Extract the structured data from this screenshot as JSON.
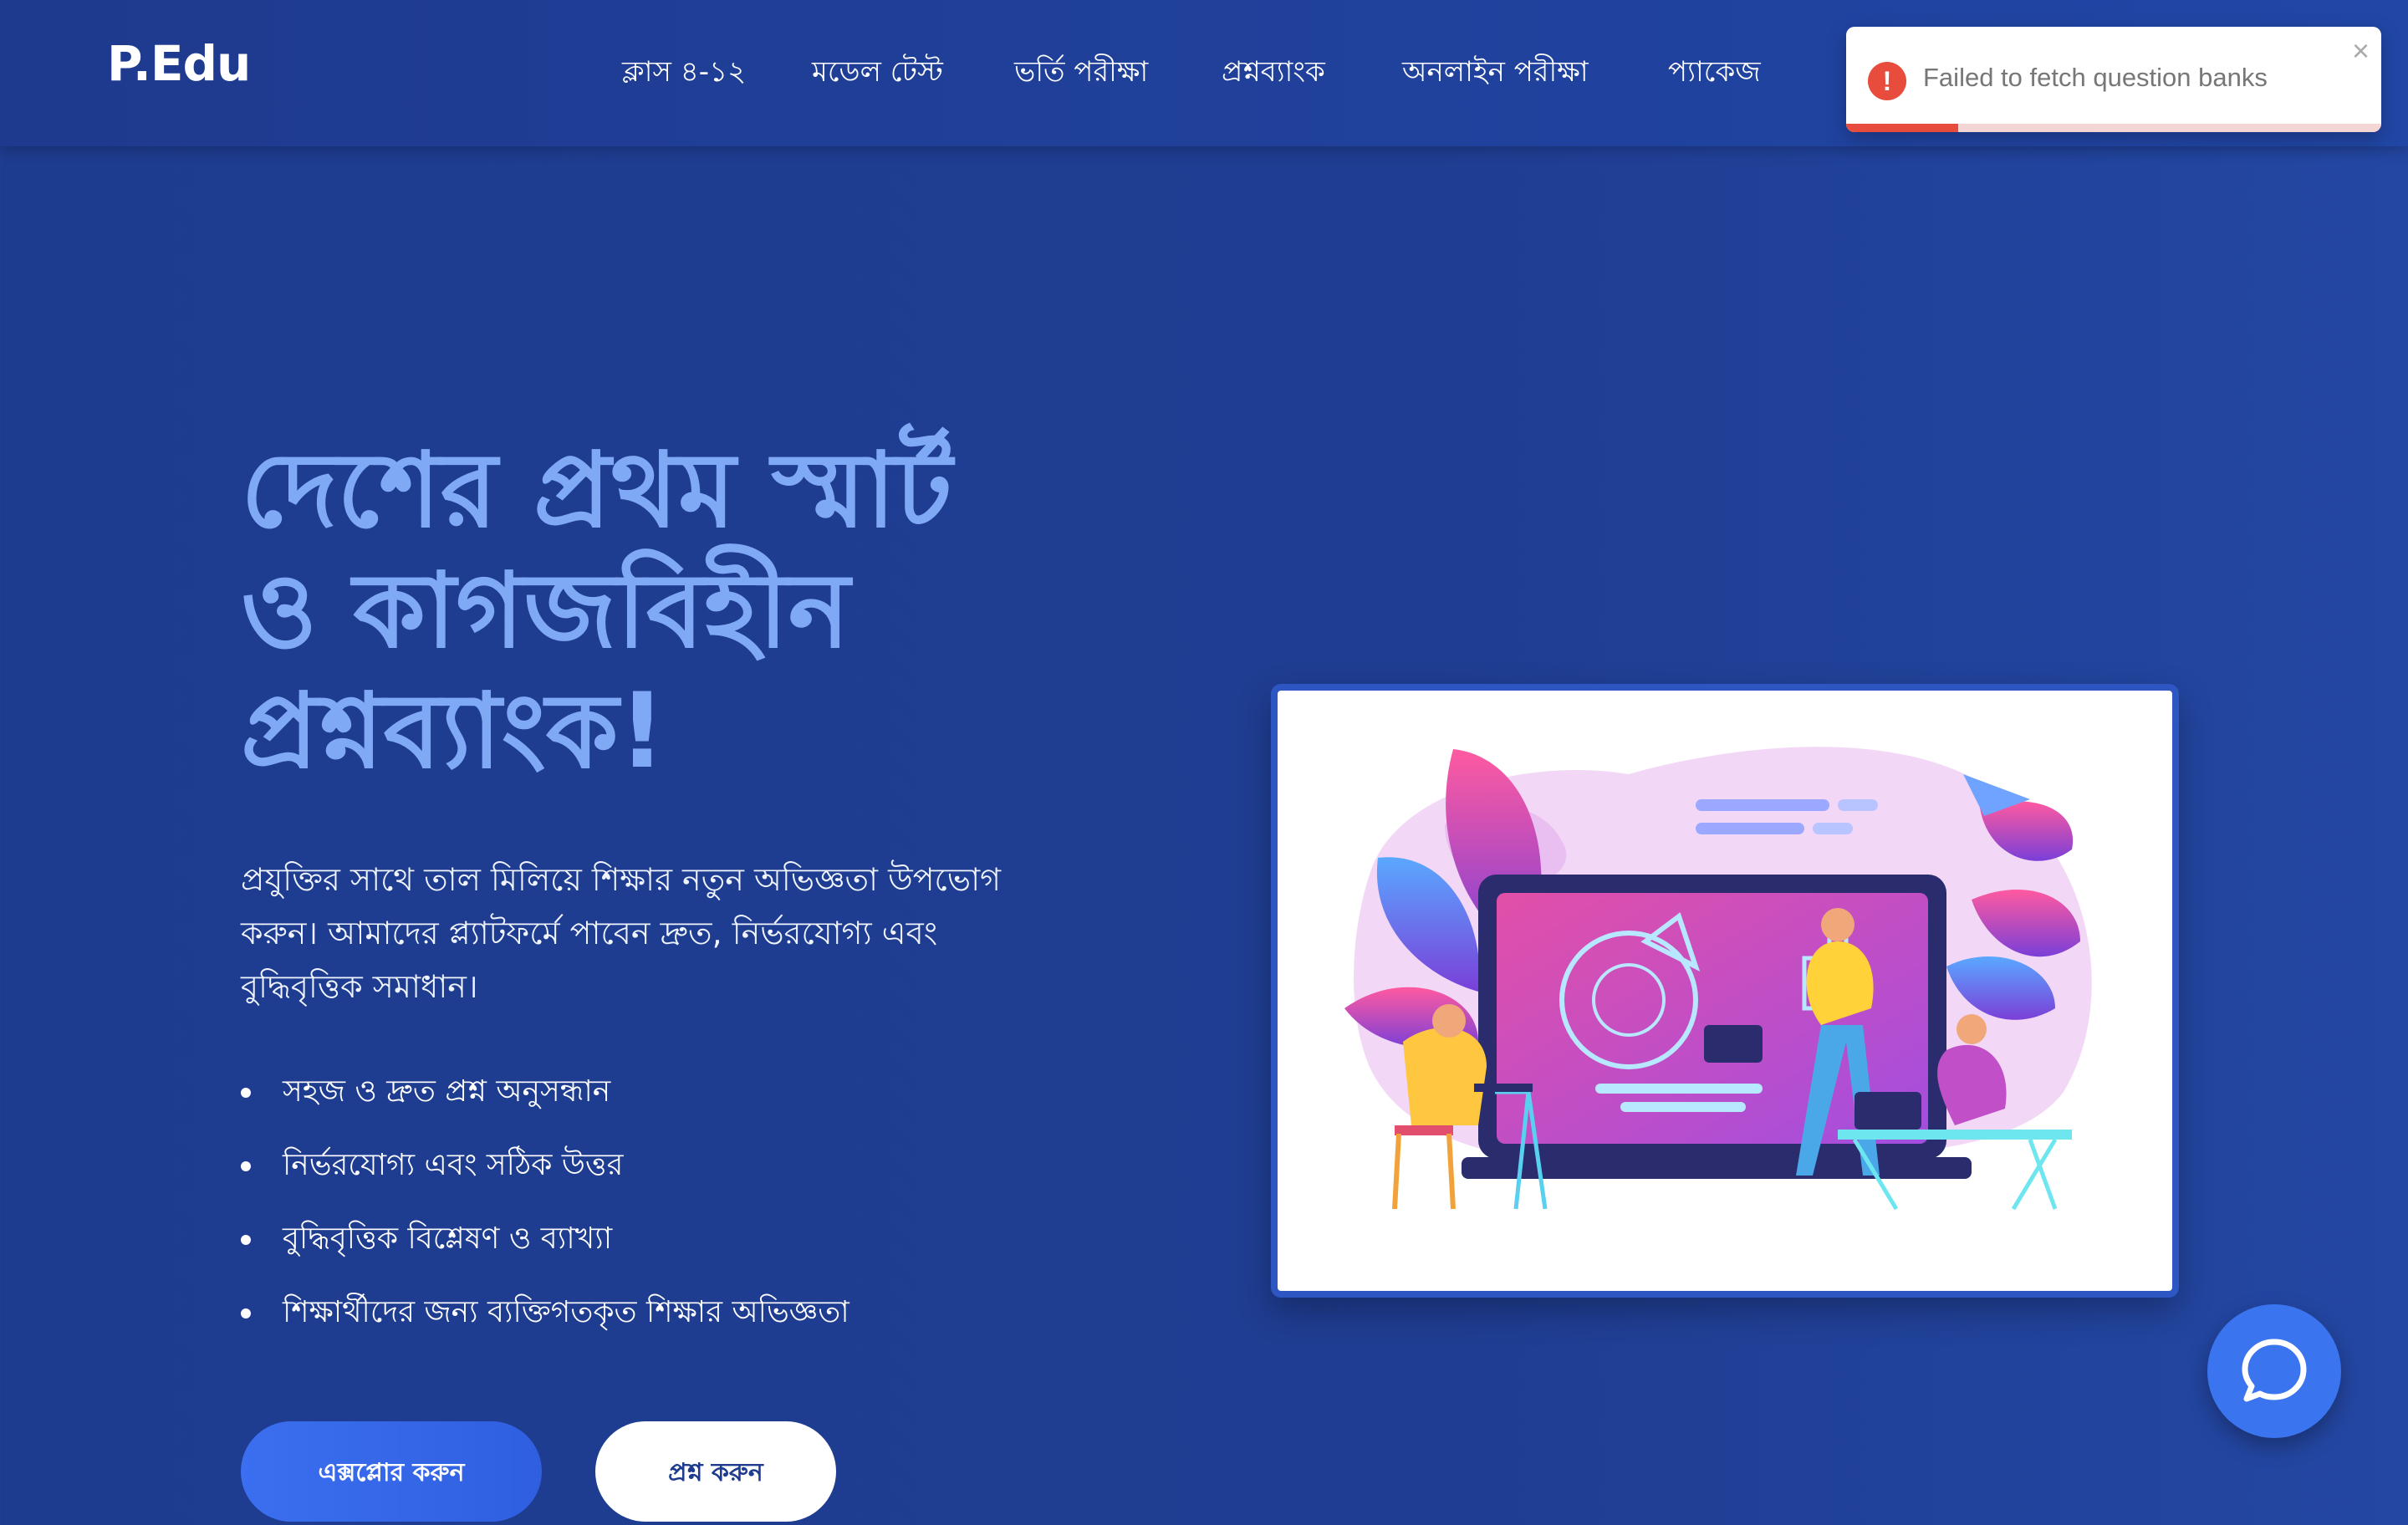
{
  "header": {
    "logo": "P.Edu",
    "nav": [
      {
        "label": "ক্লাস ৪-১২"
      },
      {
        "label": "মডেল টেস্ট"
      },
      {
        "label": "ভর্তি পরীক্ষা"
      },
      {
        "label": "প্রশ্নব্যাংক"
      },
      {
        "label": "অনলাইন পরীক্ষা"
      },
      {
        "label": "প্যাকেজ"
      }
    ]
  },
  "toast": {
    "icon": "alert-icon",
    "icon_glyph": "!",
    "message": "Failed to fetch question banks",
    "close_glyph": "×",
    "progress": 0.21,
    "color": "#e74c3c"
  },
  "hero": {
    "title_lines": [
      "দেশের প্রথম স্মার্ট",
      "ও কাগজবিহীন",
      "প্রশ্নব্যাংক!"
    ],
    "description": "প্রযুক্তির সাথে তাল মিলিয়ে শিক্ষার নতুন অভিজ্ঞতা উপভোগ করুন। আমাদের প্ল্যাটফর্মে পাবেন দ্রুত, নির্ভরযোগ্য এবং বুদ্ধিবৃত্তিক সমাধান।",
    "features": [
      "সহজ ও দ্রুত প্রশ্ন অনুসন্ধান",
      "নির্ভরযোগ্য এবং সঠিক উত্তর",
      "বুদ্ধিবৃত্তিক বিশ্লেষণ ও ব্যাখ্যা",
      "শিক্ষার্থীদের জন্য ব্যক্তিগতকৃত শিক্ষার অভিজ্ঞতা"
    ],
    "primary_button": "এক্সপ্লোর করুন",
    "secondary_button": "প্রশ্ন করুন"
  },
  "illustration": {
    "icon": "classroom-illustration"
  },
  "chat": {
    "icon": "chat-bubble-icon"
  },
  "colors": {
    "background": "#1f3d92",
    "title": "#7fa9f5",
    "accent": "#3a74ef"
  }
}
